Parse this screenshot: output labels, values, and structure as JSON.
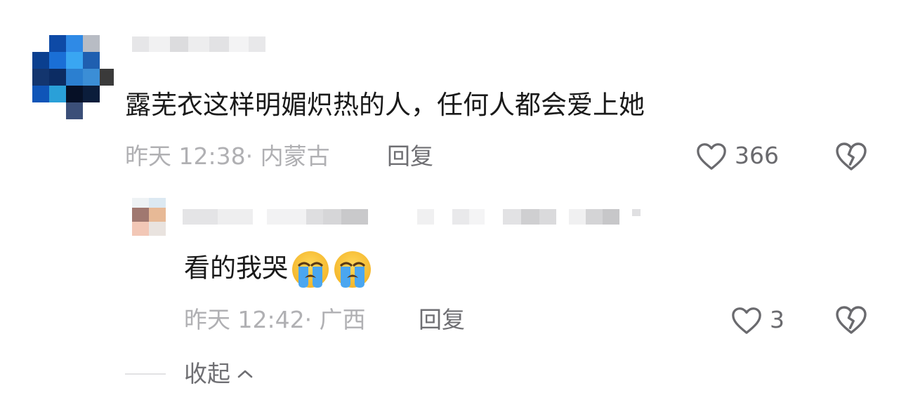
{
  "comment": {
    "text": "露芜衣这样明媚炽热的人，任何人都会爱上她",
    "time": "昨天 12:38",
    "location_sep": "·",
    "location": "内蒙古",
    "reply_label": "回复",
    "likes": "366"
  },
  "reply": {
    "text": "看的我哭",
    "emoji": "loudly-crying-face",
    "emoji_count": 2,
    "time": "昨天 12:42",
    "location_sep": "·",
    "location": "广西",
    "reply_label": "回复",
    "likes": "3"
  },
  "collapse_label": "收起",
  "colors": {
    "text": "#1a1a1a",
    "meta": "#b0b0b3",
    "action": "#6f6f73",
    "icon": "#6a6a6e"
  }
}
